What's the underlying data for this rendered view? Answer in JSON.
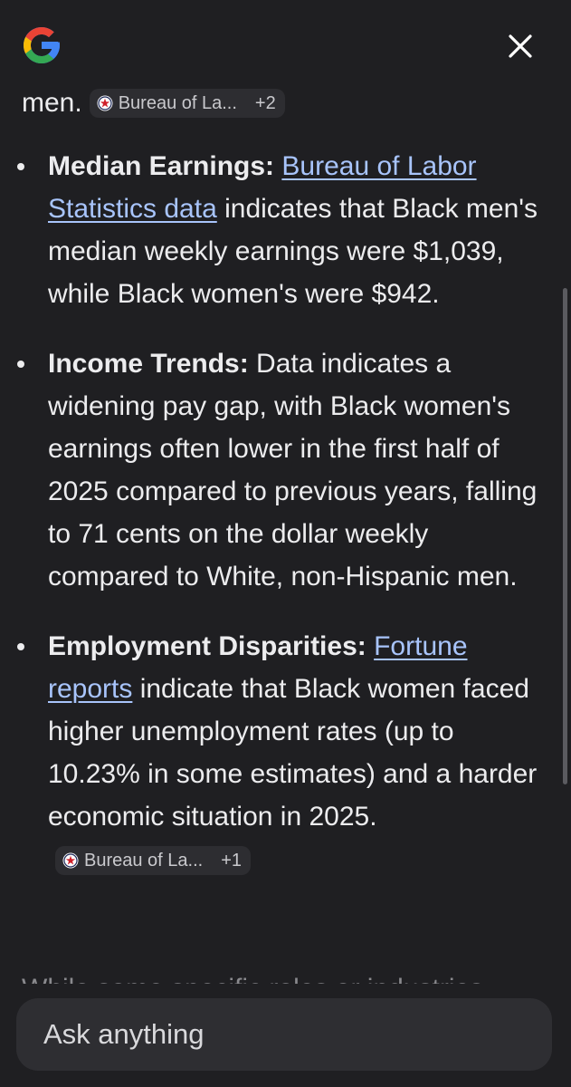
{
  "header": {
    "logo_icon": "google-g-icon",
    "close_icon": "close-icon"
  },
  "lead": {
    "text": "men.",
    "chip": {
      "label": "Bureau of La...",
      "more": "+2",
      "icon": "bls-star-icon"
    }
  },
  "bullets": [
    {
      "heading": "Median Earnings:",
      "link": "Bureau of Labor Statistics data",
      "text": " indicates that Black men's median weekly earnings were $1,039, while Black women's were $942."
    },
    {
      "heading": "Income Trends:",
      "text": " Data indicates a widening pay gap, with Black women's earnings often lower in the first half of 2025 compared to previous years, falling to 71 cents on the dollar weekly compared to White, non-Hispanic men."
    },
    {
      "heading": "Employment Disparities:",
      "link": "Fortune reports",
      "text": " indicate that Black women faced higher unemployment rates (up to 10.23% in some estimates) and a harder economic situation in 2025.",
      "chip": {
        "label": "Bureau of La...",
        "more": "+1",
        "icon": "bls-star-icon"
      }
    }
  ],
  "trailing_text": "While some specific roles or industries",
  "input": {
    "placeholder": "Ask anything"
  },
  "colors": {
    "background": "#1f1f22",
    "link": "#a8c4fb",
    "chip_bg": "#2d2d31",
    "input_bg": "#2e2e32"
  }
}
